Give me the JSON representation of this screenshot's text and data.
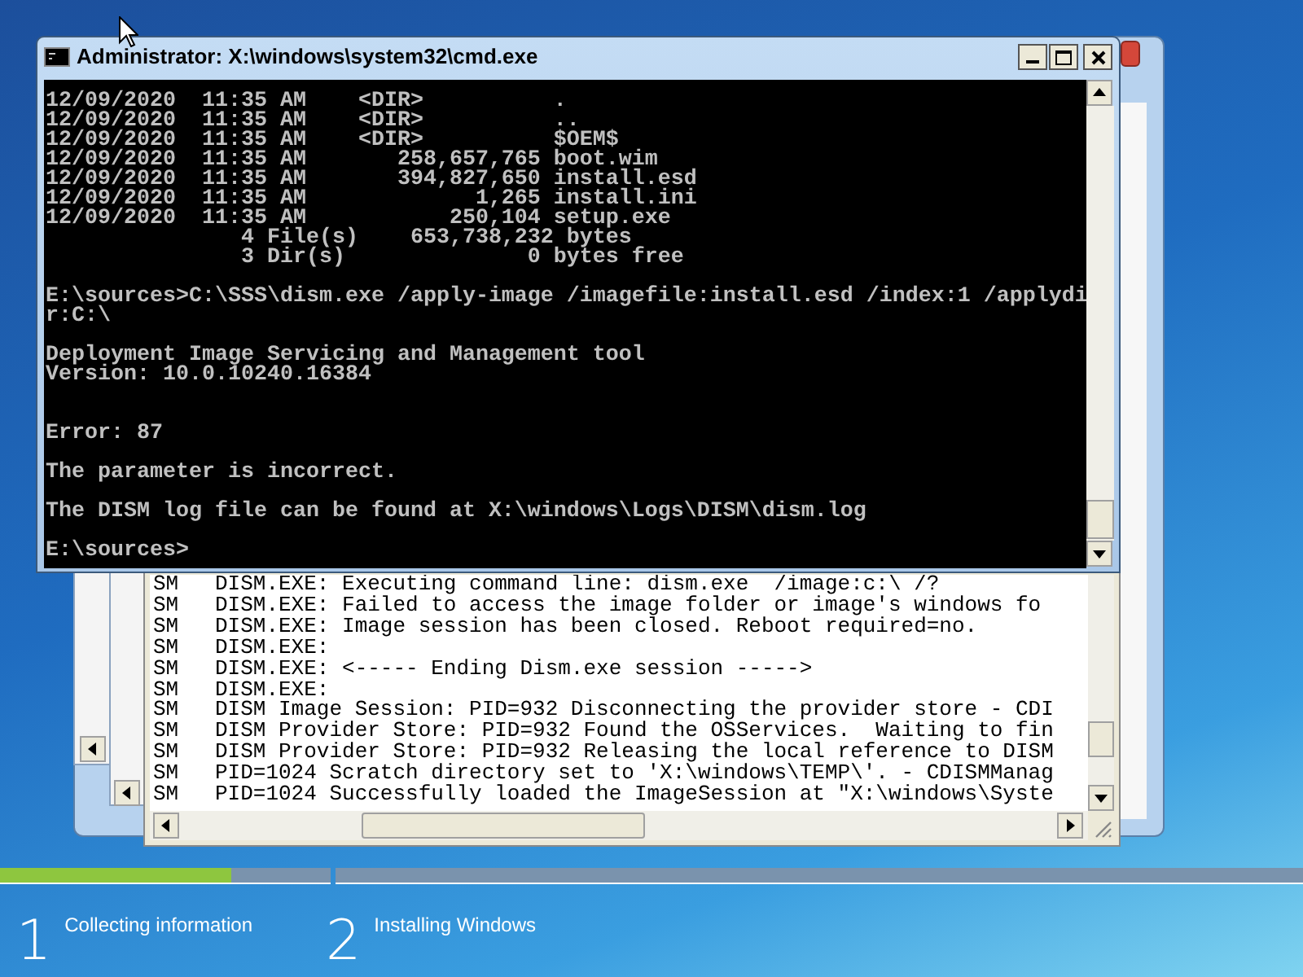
{
  "cmd_window": {
    "title": "Administrator: X:\\windows\\system32\\cmd.exe",
    "lines": [
      {
        "kind": "text",
        "text": "12/09/2020  11:35 AM    <DIR>          ."
      },
      {
        "kind": "text",
        "text": "12/09/2020  11:35 AM    <DIR>          .."
      },
      {
        "kind": "text",
        "text": "12/09/2020  11:35 AM    <DIR>          $OEM$"
      },
      {
        "kind": "text",
        "text": "12/09/2020  11:35 AM       258,657,765 boot.wim"
      },
      {
        "kind": "text",
        "text": "12/09/2020  11:35 AM       394,827,650 install.esd"
      },
      {
        "kind": "text",
        "text": "12/09/2020  11:35 AM             1,265 install.ini"
      },
      {
        "kind": "text",
        "text": "12/09/2020  11:35 AM           250,104 setup.exe"
      },
      {
        "kind": "text",
        "text": "               4 File(s)    653,738,232 bytes"
      },
      {
        "kind": "text",
        "text": "               3 Dir(s)              0 bytes free"
      },
      {
        "kind": "blank"
      },
      {
        "kind": "text",
        "text": "E:\\sources>C:\\SSS\\dism.exe /apply-image /imagefile:install.esd /index:1 /applydi"
      },
      {
        "kind": "text",
        "text": "r:C:\\"
      },
      {
        "kind": "blank"
      },
      {
        "kind": "text",
        "text": "Deployment Image Servicing and Management tool"
      },
      {
        "kind": "text",
        "text": "Version: 10.0.10240.16384"
      },
      {
        "kind": "blank"
      },
      {
        "kind": "blank"
      },
      {
        "kind": "text",
        "text": "Error: 87"
      },
      {
        "kind": "blank"
      },
      {
        "kind": "text",
        "text": "The parameter is incorrect."
      },
      {
        "kind": "blank"
      },
      {
        "kind": "text",
        "text": "The DISM log file can be found at X:\\windows\\Logs\\DISM\\dism.log"
      },
      {
        "kind": "blank"
      },
      {
        "kind": "text",
        "text": "E:\\sources>"
      }
    ]
  },
  "log_window": {
    "rows": [
      {
        "source": "SM",
        "message": "DISM.EXE: Executing command line: dism.exe  /image:c:\\ /?"
      },
      {
        "source": "SM",
        "message": "DISM.EXE: Failed to access the image folder or image's windows fo"
      },
      {
        "source": "SM",
        "message": "DISM.EXE: Image session has been closed. Reboot required=no."
      },
      {
        "source": "SM",
        "message": "DISM.EXE:"
      },
      {
        "source": "SM",
        "message": "DISM.EXE: <----- Ending Dism.exe session ----->"
      },
      {
        "source": "SM",
        "message": "DISM.EXE:"
      },
      {
        "source": "SM",
        "message": "DISM Image Session: PID=932 Disconnecting the provider store - CDI"
      },
      {
        "source": "SM",
        "message": "DISM Provider Store: PID=932 Found the OSServices.  Waiting to fin"
      },
      {
        "source": "SM",
        "message": "DISM Provider Store: PID=932 Releasing the local reference to DISM"
      },
      {
        "source": "SM",
        "message": "PID=1024 Scratch directory set to 'X:\\windows\\TEMP\\'. - CDISMManag"
      },
      {
        "source": "SM",
        "message": "PID=1024 Successfully loaded the ImageSession at \"X:\\windows\\Syste"
      }
    ]
  },
  "setup_steps": [
    {
      "number": "1",
      "label": "Collecting information",
      "level": 0.7
    },
    {
      "number": "2",
      "label": "Installing Windows"
    }
  ]
}
